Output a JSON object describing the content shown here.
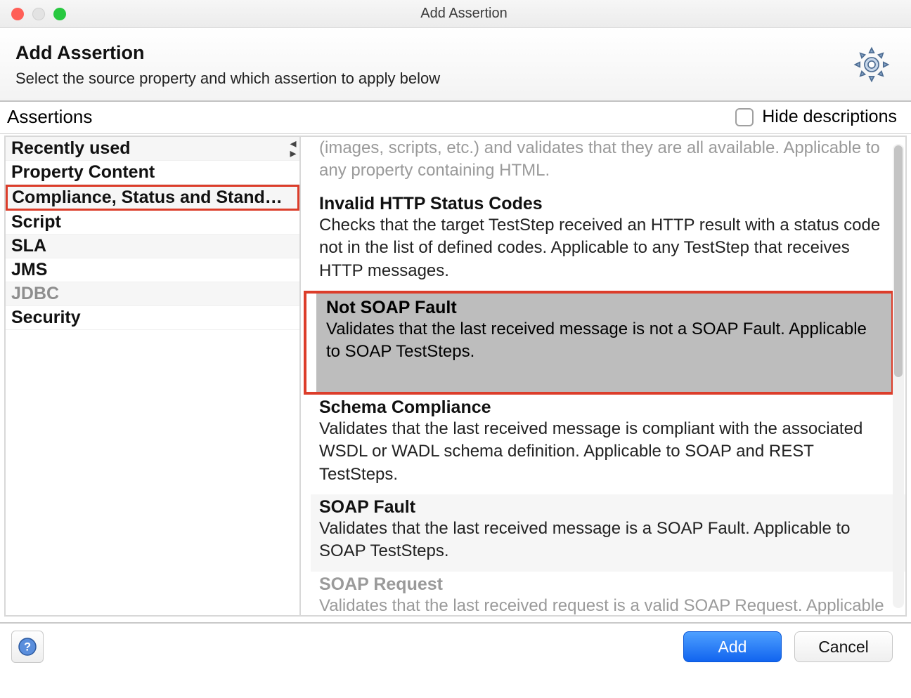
{
  "window": {
    "title": "Add Assertion"
  },
  "header": {
    "title": "Add Assertion",
    "subtitle": "Select the source property and which assertion to apply below"
  },
  "toolbar": {
    "assertions_label": "Assertions",
    "hide_descriptions_label": "Hide descriptions",
    "hide_descriptions_checked": false
  },
  "categories": [
    {
      "label": "Recently used",
      "disabled": false
    },
    {
      "label": "Property Content",
      "disabled": false
    },
    {
      "label": "Compliance, Status and Stand…",
      "disabled": false,
      "highlighted": true
    },
    {
      "label": "Script",
      "disabled": false
    },
    {
      "label": "SLA",
      "disabled": false
    },
    {
      "label": "JMS",
      "disabled": false
    },
    {
      "label": "JDBC",
      "disabled": true
    },
    {
      "label": "Security",
      "disabled": false
    }
  ],
  "assertions": [
    {
      "title": "",
      "description": "(images, scripts, etc.) and validates that they are all available. Applicable to any property containing HTML.",
      "disabled": true,
      "truncated_top": true
    },
    {
      "title": "Invalid HTTP Status Codes",
      "description": "Checks that the target TestStep received an HTTP result with a status code not in the list of defined codes. Applicable to any TestStep that receives HTTP messages.",
      "disabled": false
    },
    {
      "title": "Not SOAP Fault",
      "description": "Validates that the last received message is not a SOAP Fault. Applicable to SOAP TestSteps.",
      "disabled": false,
      "selected": true,
      "highlighted": true
    },
    {
      "title": "Schema Compliance",
      "description": "Validates that the last received message is compliant with the associated WSDL or WADL schema definition. Applicable to SOAP and REST TestSteps.",
      "disabled": false
    },
    {
      "title": "SOAP Fault",
      "description": "Validates that the last received message is a SOAP Fault. Applicable to SOAP TestSteps.",
      "disabled": false,
      "alt": true
    },
    {
      "title": "SOAP Request",
      "description": "Validates that the last received request is a valid SOAP Request. Applicable to MockResponse TestSteps only.",
      "disabled": true,
      "truncated_bottom": true
    }
  ],
  "buttons": {
    "add": "Add",
    "cancel": "Cancel"
  }
}
